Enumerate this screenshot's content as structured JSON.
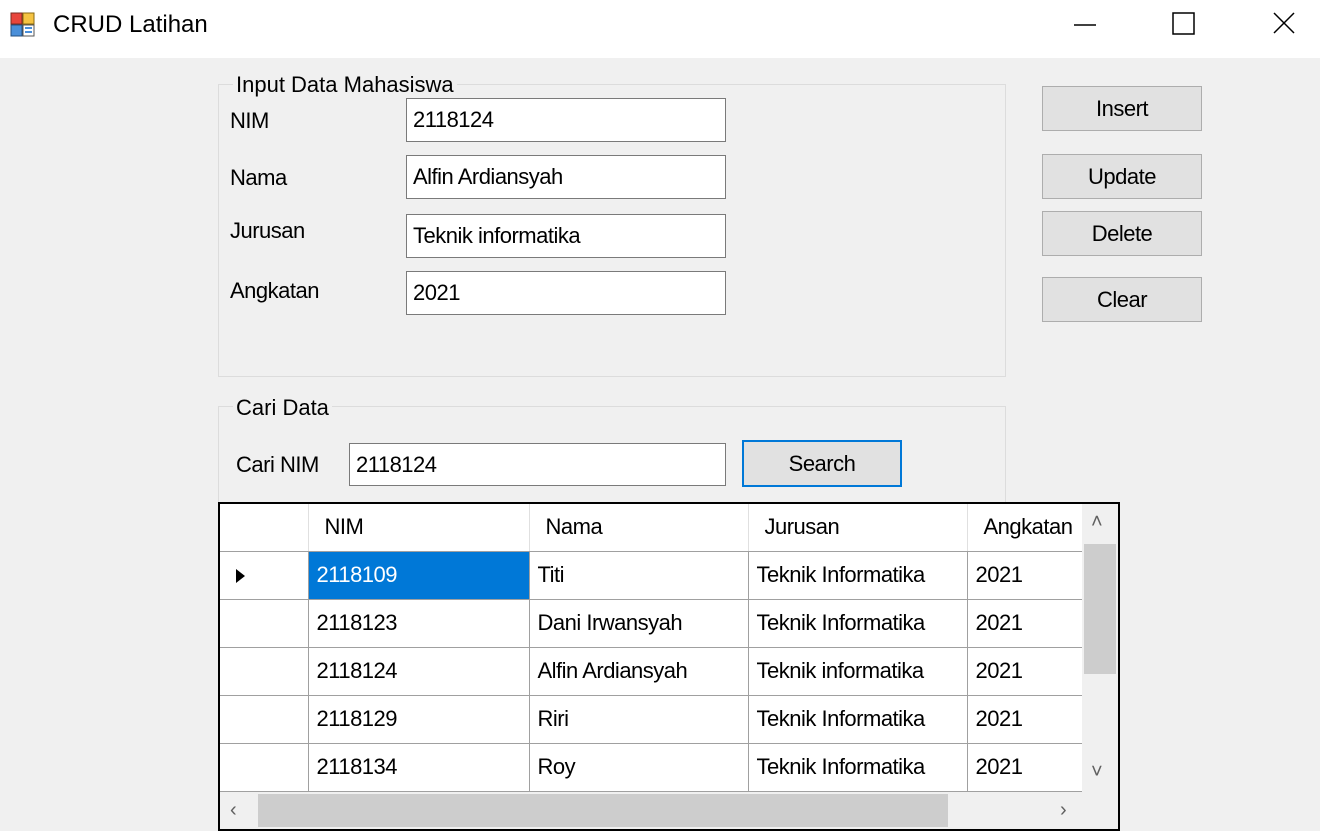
{
  "window": {
    "title": "CRUD Latihan"
  },
  "input_group": {
    "legend": "Input Data Mahasiswa",
    "nim_label": "NIM",
    "nim_value": "2118124",
    "nama_label": "Nama",
    "nama_value": "Alfin Ardiansyah",
    "jurusan_label": "Jurusan",
    "jurusan_value": "Teknik informatika",
    "angkatan_label": "Angkatan",
    "angkatan_value": "2021"
  },
  "actions": {
    "insert_label": "Insert",
    "update_label": "Update",
    "delete_label": "Delete",
    "clear_label": "Clear"
  },
  "search_group": {
    "legend": "Cari Data",
    "cari_nim_label": "Cari NIM",
    "cari_nim_value": "2118124",
    "search_label": "Search"
  },
  "grid": {
    "columns": [
      "NIM",
      "Nama",
      "Jurusan",
      "Angkatan"
    ],
    "rows": [
      {
        "nim": "2118109",
        "nama": "Titi",
        "jurusan": "Teknik Informatika",
        "angkatan": "2021",
        "current": true
      },
      {
        "nim": "2118123",
        "nama": "Dani Irwansyah",
        "jurusan": "Teknik Informatika",
        "angkatan": "2021"
      },
      {
        "nim": "2118124",
        "nama": "Alfin Ardiansyah",
        "jurusan": "Teknik informatika",
        "angkatan": "2021"
      },
      {
        "nim": "2118129",
        "nama": "Riri",
        "jurusan": "Teknik Informatika",
        "angkatan": "2021"
      },
      {
        "nim": "2118134",
        "nama": "Roy",
        "jurusan": "Teknik Informatika",
        "angkatan": "2021"
      }
    ]
  },
  "colors": {
    "selection": "#0078d7",
    "focus_border": "#0078d7",
    "window_bg": "#f0f0f0",
    "button_bg": "#e1e1e1"
  },
  "icons": {
    "app": "form-app-icon",
    "minimize": "minimize-icon",
    "maximize": "maximize-icon",
    "close": "close-icon",
    "row_indicator": "row-indicator-arrow-icon",
    "scroll_up": "chevron-up-icon",
    "scroll_down": "chevron-down-icon",
    "scroll_left": "chevron-left-icon",
    "scroll_right": "chevron-right-icon"
  }
}
